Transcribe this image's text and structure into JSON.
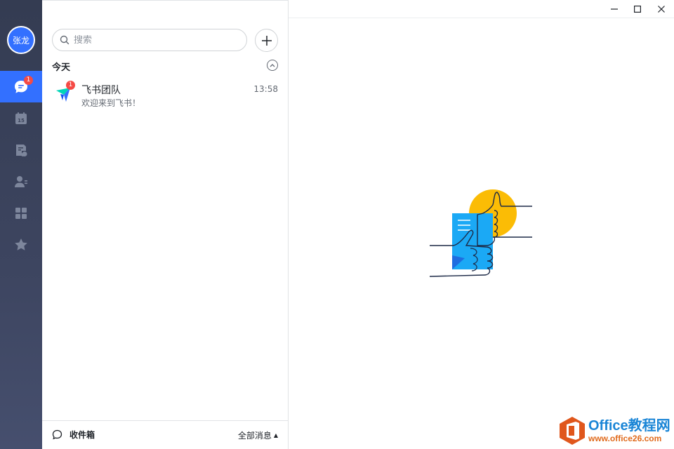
{
  "user": {
    "avatar_text": "张龙"
  },
  "sidebar": {
    "items": [
      {
        "name": "messages",
        "icon": "chat-bubble-icon",
        "badge": "1",
        "active": true
      },
      {
        "name": "calendar",
        "icon": "calendar-icon",
        "calendar_day": "15"
      },
      {
        "name": "docs",
        "icon": "document-cloud-icon"
      },
      {
        "name": "contacts",
        "icon": "contacts-icon"
      },
      {
        "name": "workplace",
        "icon": "apps-grid-icon"
      },
      {
        "name": "favorites",
        "icon": "star-icon"
      }
    ]
  },
  "search": {
    "placeholder": "搜索"
  },
  "chat_list": {
    "section_title": "今天",
    "items": [
      {
        "name": "飞书团队",
        "time": "13:58",
        "preview": "欢迎来到飞书！",
        "badge": "1"
      }
    ]
  },
  "bottom_bar": {
    "inbox_label": "收件箱",
    "filter_label": "全部消息"
  },
  "watermark": {
    "title": "Office教程网",
    "url": "www.office26.com"
  },
  "colors": {
    "accent": "#3370ff",
    "badge": "#f54a45",
    "sidebar_bg": "#3a4259",
    "illustration_yellow": "#fbbc05",
    "illustration_blue": "#1ba9f5"
  }
}
